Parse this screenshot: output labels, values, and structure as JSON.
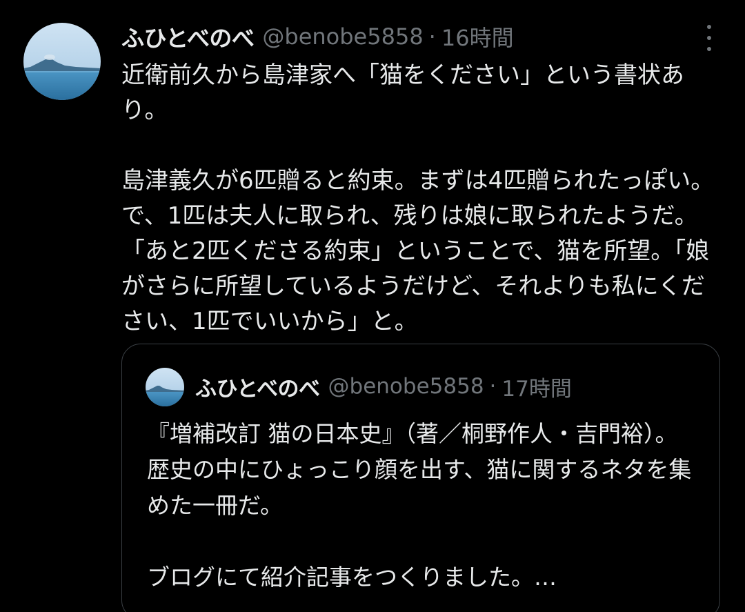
{
  "tweet": {
    "author_name": "ふひとべのべ",
    "handle": "@benobe5858",
    "separator": "·",
    "time": "16時間",
    "avatar_icon": "avatar-volcano-sea-icon",
    "text": "近衛前久から島津家へ「猫をください」という書状あり。\n\n島津義久が6匹贈ると約束。まずは4匹贈られたっぽい。で、1匹は夫人に取られ、残りは娘に取られたようだ。「あと2匹くださる約束」ということで、猫を所望。「娘がさらに所望しているようだけど、それよりも私にください、1匹でいいから」と。"
  },
  "quote": {
    "author_name": "ふひとべのべ",
    "handle": "@benobe5858",
    "separator": "·",
    "time": "17時間",
    "text": "『増補改訂 猫の日本史』（著／桐野作人・吉門裕）。歴史の中にひょっこり顔を出す、猫に関するネタを集めた一冊だ。\n\nブログにて紹介記事をつくりました。…"
  },
  "colors": {
    "background": "#000000",
    "text": "#e7e9ea",
    "secondary": "#71767b",
    "border": "#3a3f44"
  }
}
